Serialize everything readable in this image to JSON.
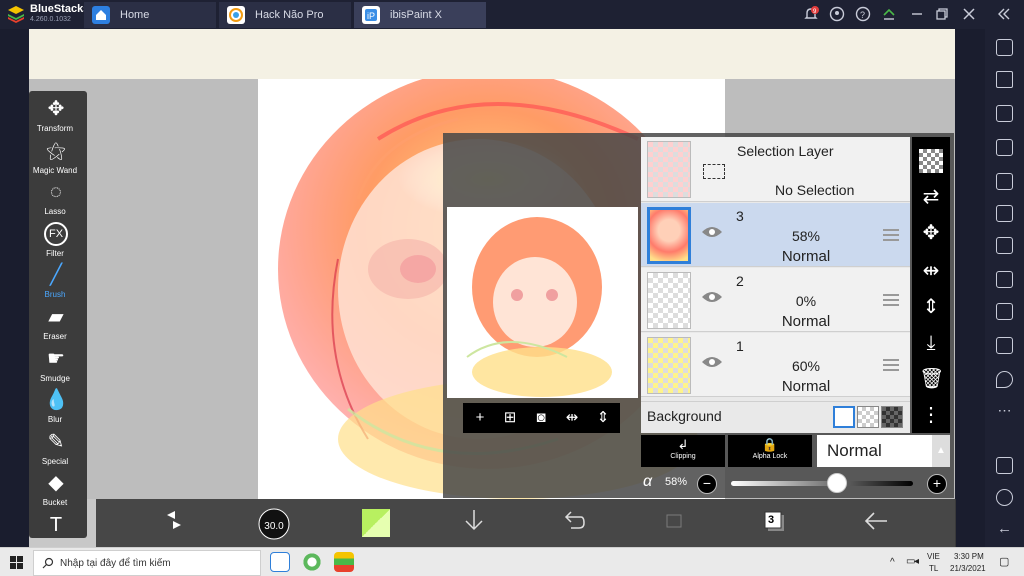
{
  "window": {
    "app_name": "BlueStacks",
    "app_version": "4.260.0.1032",
    "tabs": [
      {
        "label": "Home",
        "icon": "home-icon"
      },
      {
        "label": "Hack Não Pro",
        "icon": "app-icon"
      },
      {
        "label": "ibisPaint X",
        "icon": "ibispaint-icon"
      }
    ],
    "notification_count": "9"
  },
  "tools": [
    {
      "label": "Transform",
      "icon": "move-arrows-icon"
    },
    {
      "label": "Magic Wand",
      "icon": "magic-wand-icon"
    },
    {
      "label": "Lasso",
      "icon": "lasso-icon"
    },
    {
      "label": "Filter",
      "icon": "fx-icon",
      "glyph": "FX"
    },
    {
      "label": "Brush",
      "icon": "brush-icon",
      "active": true
    },
    {
      "label": "Eraser",
      "icon": "eraser-icon"
    },
    {
      "label": "Smudge",
      "icon": "smudge-icon"
    },
    {
      "label": "Blur",
      "icon": "blur-drop-icon"
    },
    {
      "label": "Special",
      "icon": "special-icon"
    },
    {
      "label": "Bucket",
      "icon": "bucket-icon"
    },
    {
      "label": "",
      "icon": "text-tool-icon",
      "glyph": "T"
    }
  ],
  "bottom_bar": {
    "brush_size": "30.0",
    "layer_count": "3",
    "primary_color": "#b8f060"
  },
  "layers_panel": {
    "selection_layer": {
      "title": "Selection Layer",
      "status": "No Selection"
    },
    "layers": [
      {
        "number": "3",
        "opacity": "58%",
        "mode": "Normal",
        "selected": true
      },
      {
        "number": "2",
        "opacity": "0%",
        "mode": "Normal",
        "selected": false
      },
      {
        "number": "1",
        "opacity": "60%",
        "mode": "Normal",
        "selected": false
      }
    ],
    "background_label": "Background",
    "clipping_label": "Clipping",
    "alpha_lock_label": "Alpha Lock",
    "blend_mode": "Normal",
    "opacity_symbol": "α",
    "opacity_value": "58%",
    "opacity_level": 0.58
  },
  "taskbar": {
    "search_placeholder": "Nhập tại đây để tìm kiếm",
    "lang_top": "VIE",
    "lang_bottom": "TL",
    "time": "3:30 PM",
    "date": "21/3/2021"
  },
  "colors": {
    "accent_blue": "#2f7fd9",
    "selected_layer_bg": "#cbd9ee",
    "active_tool": "#4ba8ff"
  }
}
